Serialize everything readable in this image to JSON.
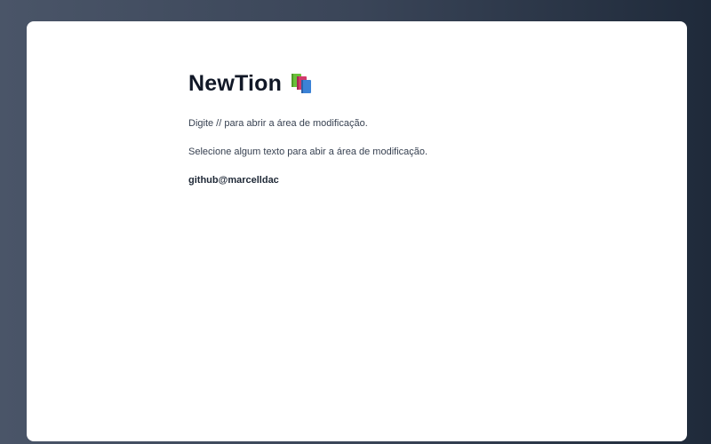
{
  "document": {
    "title": "NewTion",
    "title_icon": "books-icon",
    "paragraphs": [
      "Digite // para abrir a área de modificação.",
      "Selecione algum texto para abir a área de modificação.",
      "github@marcelldac"
    ]
  },
  "colors": {
    "background_left": "#4a5568",
    "background_right": "#1f2a3a",
    "card": "#ffffff",
    "title": "#111827"
  }
}
